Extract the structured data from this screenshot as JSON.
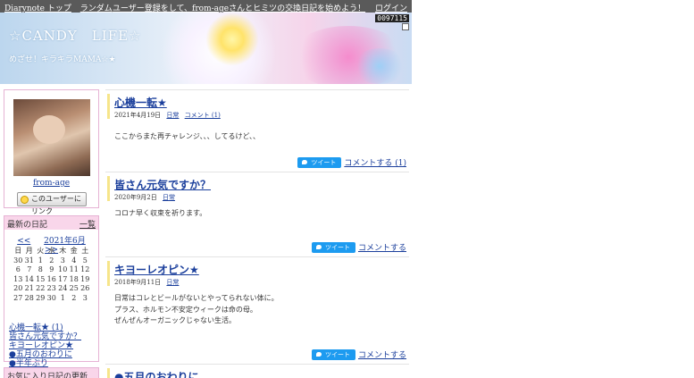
{
  "topbar": {
    "links": [
      "Diarynote トップ",
      "ランダム"
    ],
    "promo": "ユーザー登録をして、from-ageさんとヒミツの交換日記を始めよう！",
    "login": "ログイン"
  },
  "header": {
    "title": "☆CANDY　LIFE☆",
    "subtitle": "めざせ！キラキラMAMA☆★",
    "counter": "0097115"
  },
  "profile": {
    "username": "from-age",
    "link_button": "このユーザーにリンク"
  },
  "recent": {
    "title": "最新の日記",
    "all_link": "一覧",
    "prev": "<<",
    "month": "2021年6月",
    "next": ">>",
    "weekdays": [
      "日",
      "月",
      "火",
      "水",
      "木",
      "金",
      "土"
    ],
    "weeks": [
      [
        "30",
        "31",
        "1",
        "2",
        "3",
        "4",
        "5"
      ],
      [
        "6",
        "7",
        "8",
        "9",
        "10",
        "11",
        "12"
      ],
      [
        "13",
        "14",
        "15",
        "16",
        "17",
        "18",
        "19"
      ],
      [
        "20",
        "21",
        "22",
        "23",
        "24",
        "25",
        "26"
      ],
      [
        "27",
        "28",
        "29",
        "30",
        "1",
        "2",
        "3"
      ]
    ],
    "entries": [
      "心機一転★ (1)",
      "皆さん元気ですか？",
      "キヨーレオピン★",
      "●五月のおわりに",
      "●半年ぶり"
    ]
  },
  "favorites": {
    "title": "お気に入り日記の更新"
  },
  "entries": [
    {
      "title": "心機一転★",
      "date": "2021年4月19日",
      "category": "日常",
      "comment_meta": "コメント (1)",
      "body": [
        "ここからまた再チャレンジ、、、してるけど、、"
      ],
      "tweet": "ツイート",
      "comment_link": "コメントする (1)"
    },
    {
      "title": "皆さん元気ですか？",
      "date": "2020年9月2日",
      "category": "日常",
      "comment_meta": "",
      "body": [
        "コロナ早く収束を祈ります。"
      ],
      "tweet": "ツイート",
      "comment_link": "コメントする"
    },
    {
      "title": "キヨーレオピン★",
      "date": "2018年9月11日",
      "category": "日常",
      "comment_meta": "",
      "body": [
        "日常はコレとビールがないとやってられない体に。",
        "プラス、ホルモン不安定ウィークは命の母。",
        "ぜんぜんオーガニックじゃない生活。"
      ],
      "tweet": "ツイート",
      "comment_link": "コメントする"
    },
    {
      "title": "●五月のおわりに",
      "date": "",
      "category": "",
      "comment_meta": "",
      "body": [],
      "tweet": "",
      "comment_link": ""
    }
  ]
}
